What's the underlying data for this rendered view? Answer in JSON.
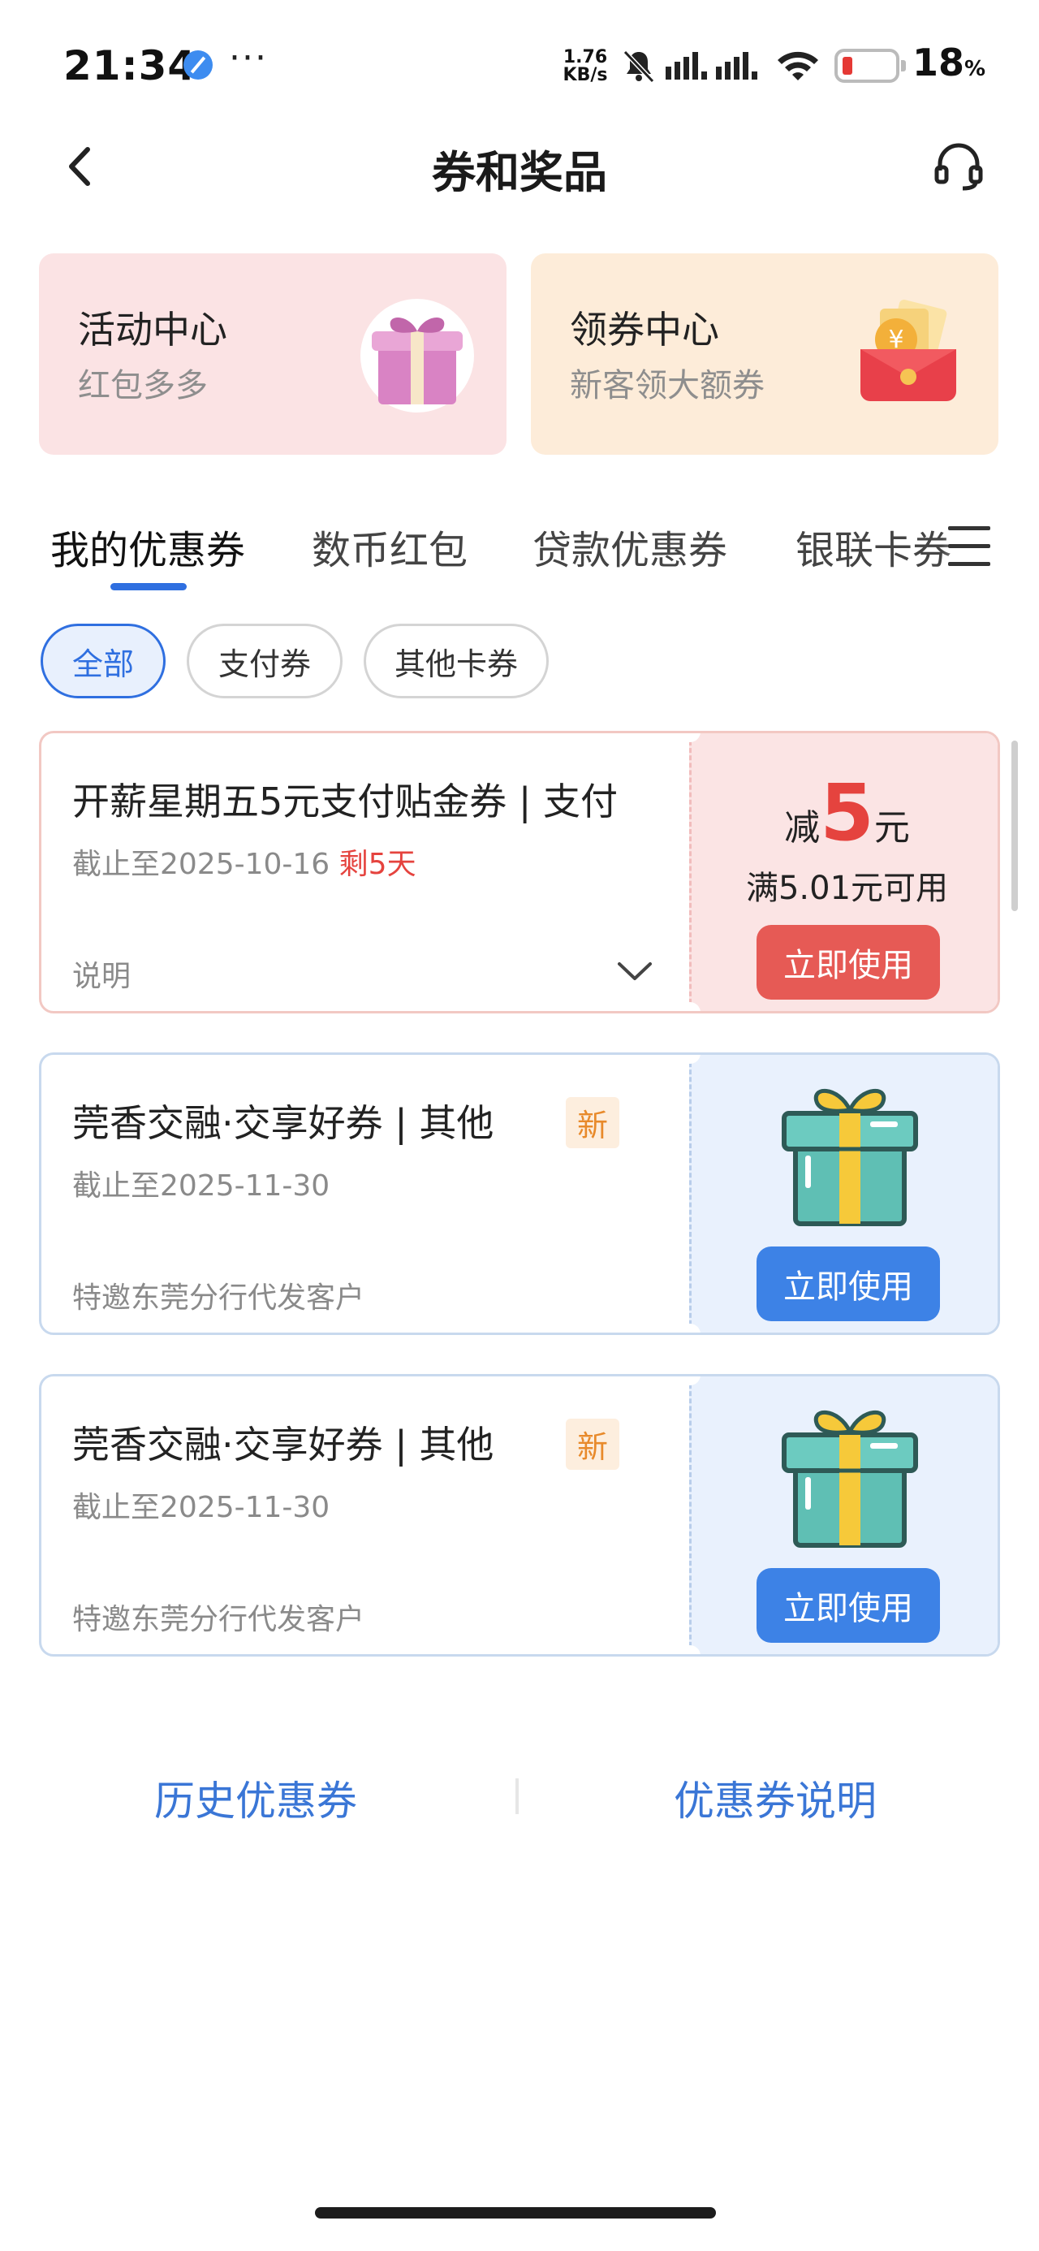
{
  "status_bar": {
    "time": "21:34",
    "dots": "···",
    "speed_value": "1.76",
    "speed_unit": "KB/s",
    "battery_level": "18",
    "battery_unit": "%"
  },
  "nav": {
    "title": "券和奖品",
    "back_icon": "chevron-left-icon",
    "service_icon": "headset-icon"
  },
  "promos": [
    {
      "title": "活动中心",
      "subtitle": "红包多多",
      "icon": "gift-box-icon"
    },
    {
      "title": "领券中心",
      "subtitle": "新客领大额券",
      "icon": "red-envelope-icon"
    }
  ],
  "tabs": [
    {
      "label": "我的优惠券",
      "active": true
    },
    {
      "label": "数币红包"
    },
    {
      "label": "贷款优惠券"
    },
    {
      "label": "银联卡券"
    }
  ],
  "filters": [
    {
      "label": "全部",
      "active": true
    },
    {
      "label": "支付券"
    },
    {
      "label": "其他卡券"
    }
  ],
  "coupons": [
    {
      "title": "开薪星期五5元支付贴金券 | 支付",
      "deadline": "截止至2025-10-16",
      "remain": "剩5天",
      "footer": "说明",
      "amount_prefix": "减",
      "amount": "5",
      "amount_unit": "元",
      "condition": "满5.01元可用",
      "button": "立即使用",
      "color": "#e65a55"
    },
    {
      "title": "莞香交融·交享好券 | 其他",
      "badge": "新",
      "deadline": "截止至2025-11-30",
      "footer": "特邀东莞分行代发客户",
      "button": "立即使用",
      "color": "#3d82e6"
    },
    {
      "title": "莞香交融·交享好券 | 其他",
      "badge": "新",
      "deadline": "截止至2025-11-30",
      "footer": "特邀东莞分行代发客户",
      "button": "立即使用",
      "color": "#3d82e6"
    }
  ],
  "bottom_links": {
    "history": "历史优惠券",
    "explanation": "优惠券说明"
  },
  "colors": {
    "accent_blue": "#2f6fe0",
    "link_blue": "#3a76d6",
    "alert_red": "#e5433e",
    "new_badge_orange": "#e88a2b"
  }
}
